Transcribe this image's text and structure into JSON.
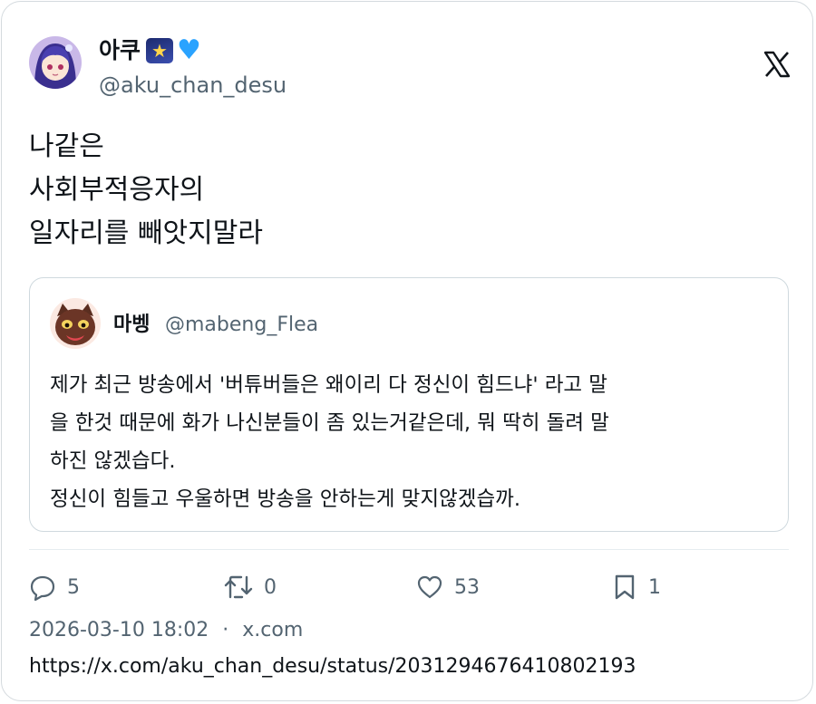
{
  "tweet": {
    "author": {
      "name": "아쿠",
      "handle": "@aku_chan_desu",
      "emojis": [
        "star-night-emoji",
        "blue-heart-emoji"
      ]
    },
    "brand_icon": "x-logo-icon",
    "text_lines": [
      "나같은",
      "사회부적응자의",
      "일자리를 빼앗지말라"
    ]
  },
  "quote": {
    "author": {
      "name": "마벵",
      "handle": "@mabeng_Flea"
    },
    "text_lines": [
      "제가 최근 방송에서 '버튜버들은 왜이리 다 정신이 힘드냐' 라고 말",
      "을 한것 때문에 화가 나신분들이 좀 있는거같은데, 뭐 딱히 돌려 말",
      "하진 않겠습다.",
      "정신이 힘들고 우울하면 방송을 안하는게 맞지않겠습까."
    ]
  },
  "stats": {
    "replies": "5",
    "retweets": "0",
    "likes": "53",
    "bookmarks": "1"
  },
  "meta": {
    "timestamp": "2026-03-10 18:02",
    "separator": "·",
    "source": "x.com",
    "url": "https://x.com/aku_chan_desu/status/2031294676410802193"
  },
  "colors": {
    "text": "#0f1419",
    "secondary": "#536471",
    "border": "#cfd9de",
    "heart_emoji": "#2aa3ff"
  }
}
